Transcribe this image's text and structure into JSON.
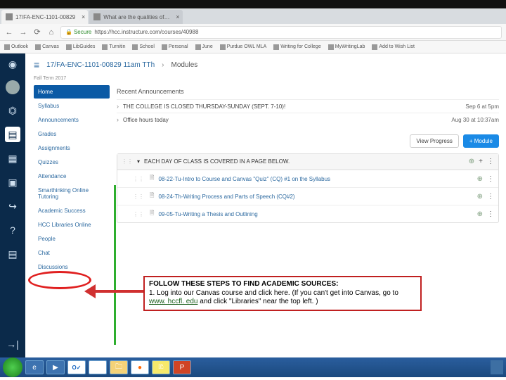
{
  "browser": {
    "tabs": [
      {
        "title": "17/FA-ENC-1101-00829",
        "active": true
      },
      {
        "title": "What are the qualities of…",
        "active": false
      }
    ],
    "nav_back": "←",
    "nav_fwd": "→",
    "nav_reload": "⟳",
    "nav_home": "⌂",
    "secure_label": "Secure",
    "url": "https://hcc.instructure.com/courses/40988",
    "bookmarks": [
      "Outlook",
      "Canvas",
      "LibGuides",
      "Turnitin",
      "School",
      "Personal",
      "June",
      "Purdue OWL MLA",
      "Writing for College",
      "MyWritingLab",
      "Add to Wish List"
    ]
  },
  "canvas": {
    "breadcrumb": {
      "course": "17/FA-ENC-1101-00829 11am TTh",
      "sep": "›",
      "page": "Modules",
      "hamburger": "≡"
    },
    "term": "Fall Term 2017",
    "nav": [
      "Home",
      "Syllabus",
      "Announcements",
      "Grades",
      "Assignments",
      "Quizzes",
      "Attendance",
      "Smarthinking Online Tutoring",
      "Academic Success",
      "HCC Libraries Online",
      "People",
      "Chat",
      "Discussions"
    ],
    "announcements_title": "Recent Announcements",
    "announcements": [
      {
        "title": "THE COLLEGE IS CLOSED THURSDAY-SUNDAY (SEPT. 7-10)!",
        "date": "Sep 6 at 5pm"
      },
      {
        "title": "Office hours today",
        "date": "Aug 30 at 10:37am"
      }
    ],
    "buttons": {
      "view_progress": "View Progress",
      "add_module": "+ Module"
    },
    "module_header": {
      "caret": "▾",
      "title": "EACH DAY OF CLASS IS COVERED IN A PAGE BELOW.",
      "pub": "⊕",
      "plus": "+",
      "gear": "⋮"
    },
    "module_items": [
      {
        "title": "08-22-Tu-Intro to Course and Canvas \"Quiz\" (CQ) #1 on the Syllabus"
      },
      {
        "title": "08-24-Th-Writing Process and Parts of Speech (CQ#2)"
      },
      {
        "title": "09-05-Tu-Writing a Thesis and Outlining"
      }
    ]
  },
  "callout": {
    "header": "FOLLOW THESE STEPS TO FIND ACADEMIC SOURCES:",
    "line_pre": "1. Log into our Canvas course and click here. (If you can't get into Canvas, go to ",
    "link": "www. hccfl. edu",
    "line_post": " and click \"Libraries\" near the top left. )"
  },
  "icons": {
    "drag": "⋮⋮",
    "page": "🗎",
    "pub": "⊕",
    "more": "⋮",
    "chev": "›"
  },
  "taskbar": {
    "outlook": "O✓"
  }
}
